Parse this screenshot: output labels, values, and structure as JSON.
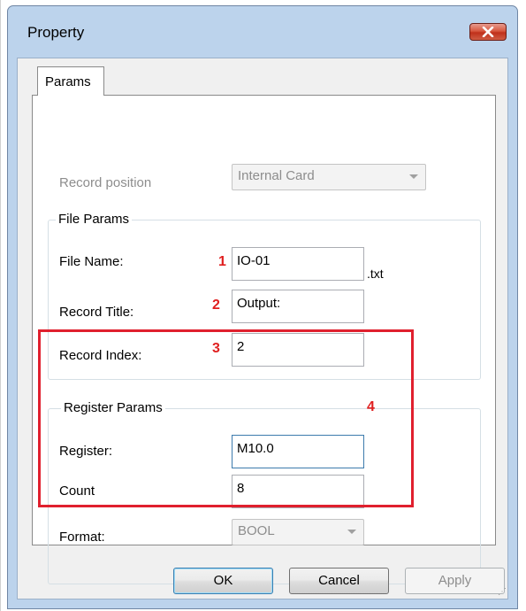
{
  "window": {
    "title": "Property",
    "close_icon": "close-icon"
  },
  "tabs": [
    {
      "label": "Params",
      "selected": true
    }
  ],
  "record_position": {
    "label": "Record position",
    "value": "Internal Card",
    "enabled": false
  },
  "file_params": {
    "legend": "File Params",
    "file_name": {
      "label": "File Name:",
      "value": "IO-01",
      "suffix": ".txt",
      "marker": "1"
    },
    "record_title": {
      "label": "Record Title:",
      "value": "Output:",
      "marker": "2"
    },
    "record_index": {
      "label": "Record Index:",
      "value": "2",
      "marker": "3"
    }
  },
  "register_params": {
    "legend": "Register Params",
    "marker": "4",
    "register": {
      "label": "Register:",
      "value": "M10.0"
    },
    "count": {
      "label": "Count",
      "value": "8"
    },
    "format": {
      "label": "Format:",
      "value": "BOOL",
      "enabled": false
    }
  },
  "buttons": {
    "ok": "OK",
    "cancel": "Cancel",
    "apply": "Apply"
  },
  "colors": {
    "annotation_red": "#e0202e",
    "frame_blue": "#bcd3ec",
    "close_red": "#c0301b"
  }
}
